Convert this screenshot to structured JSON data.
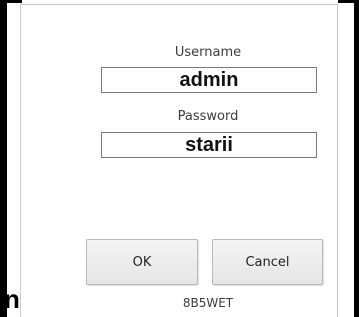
{
  "login": {
    "username_label": "Username",
    "username_value": "admin",
    "password_label": "Password",
    "password_value": "starii",
    "ok_label": "OK",
    "cancel_label": "Cancel",
    "version_code": "8B5WET"
  },
  "background_overlay": {
    "stray_glyph": "n"
  },
  "colors": {
    "frame": "#000000",
    "panel_bg": "#ffffff",
    "field_border": "#7a7a7a",
    "button_bg": "#ececec",
    "label_text": "#3c3c3c"
  }
}
